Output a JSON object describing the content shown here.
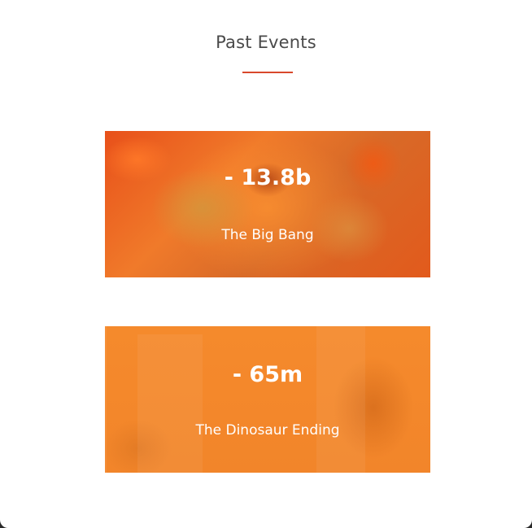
{
  "section": {
    "title": "Past Events",
    "accent_color": "#d9482b"
  },
  "events": [
    {
      "value": "- 13.8b",
      "label": "The Big Bang",
      "background": "orange explosion image"
    },
    {
      "value": "- 65m",
      "label": "The Dinosaur Ending",
      "background": "orange city with dinosaur image"
    }
  ]
}
